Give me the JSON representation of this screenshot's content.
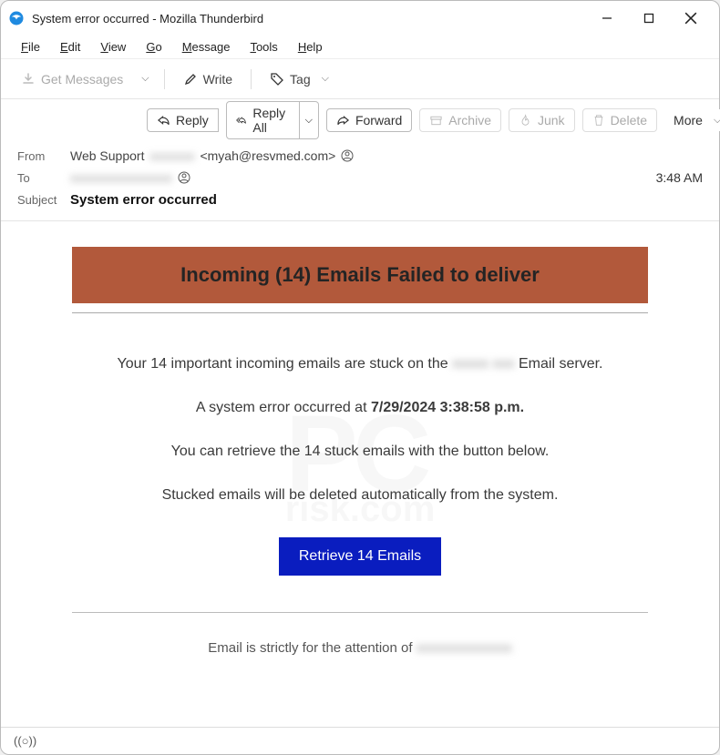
{
  "window": {
    "title": "System error occurred - Mozilla Thunderbird"
  },
  "menu": {
    "file": "File",
    "edit": "Edit",
    "view": "View",
    "go": "Go",
    "message": "Message",
    "tools": "Tools",
    "help": "Help"
  },
  "toolbar": {
    "get_messages": "Get Messages",
    "write": "Write",
    "tag": "Tag"
  },
  "actions": {
    "reply": "Reply",
    "reply_all": "Reply All",
    "forward": "Forward",
    "archive": "Archive",
    "junk": "Junk",
    "delete": "Delete",
    "more": "More"
  },
  "headers": {
    "from_label": "From",
    "from_name": "Web Support",
    "from_redacted": "xxxxxxx",
    "from_email": "<myah@resvmed.com>",
    "to_label": "To",
    "to_redacted": "xxxxxxxxxxxxxxxx",
    "time": "3:48 AM",
    "subject_label": "Subject",
    "subject": "System error occurred"
  },
  "body": {
    "banner": "Incoming (14) Emails Failed to deliver",
    "p1a": "Your 14 important incoming emails are stuck on the ",
    "p1_redacted": "xxxxx xxx",
    "p1b": " Email server.",
    "p2a": "A system error occurred at ",
    "p2_bold": "7/29/2024 3:38:58 p.m.",
    "p3": "You can retrieve the 14 stuck emails with the button below.",
    "p4": "Stucked emails will be deleted automatically from the system.",
    "cta": "Retrieve 14 Emails",
    "foot_a": "Email is strictly for the attention of ",
    "foot_redacted": "xxxxxxxxxxxxxx"
  }
}
